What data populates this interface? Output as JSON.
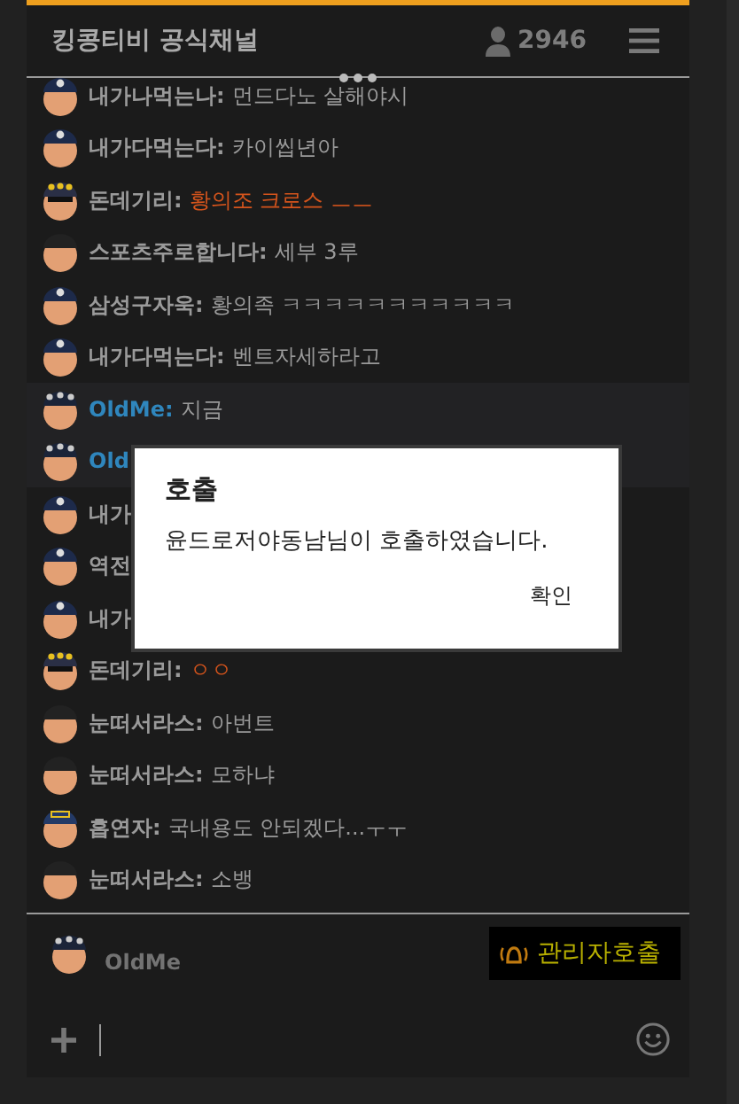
{
  "header": {
    "title": "킹콩티비 공식채널",
    "viewer_count": "2946"
  },
  "messages": [
    {
      "kind": "police",
      "name": "내가나먹는나:",
      "text": "먼드다노 살해야시",
      "self": false,
      "color": "#9a9a9a"
    },
    {
      "kind": "police",
      "name": "내가다먹는다:",
      "text": "카이씹년아",
      "self": false,
      "color": "#9a9a9a"
    },
    {
      "kind": "general",
      "name": "돈데기리:",
      "text": "황의조 크로스 ㅡㅡ",
      "self": false,
      "color": "#d4541c"
    },
    {
      "kind": "plain",
      "name": "스포츠주로합니다:",
      "text": "세부 3루",
      "self": false,
      "color": "#9a9a9a"
    },
    {
      "kind": "police",
      "name": "삼성구자욱:",
      "text": "황의족 ㅋㅋㅋㅋㅋㅋㅋㅋㅋㅋㅋ",
      "self": false,
      "color": "#9a9a9a"
    },
    {
      "kind": "police",
      "name": "내가다먹는다:",
      "text": "벤트자세하라고",
      "self": false,
      "color": "#9a9a9a"
    },
    {
      "kind": "starred",
      "name": "OldMe:",
      "text": "지금",
      "self": true,
      "color": "#9a9a9a"
    },
    {
      "kind": "starred",
      "name": "Old",
      "self": true
    },
    {
      "kind": "police",
      "name": "내가",
      "self": false
    },
    {
      "kind": "police",
      "name": "역전",
      "self": false
    },
    {
      "kind": "police",
      "name": "내가",
      "self": false
    },
    {
      "kind": "general",
      "name": "돈데기리:",
      "text": "ㅇㅇ",
      "self": false,
      "color": "#d4541c"
    },
    {
      "kind": "plain",
      "name": "눈떠서라스:",
      "text": "아번트",
      "self": false,
      "color": "#9a9a9a"
    },
    {
      "kind": "plain",
      "name": "눈떠서라스:",
      "text": "모하냐",
      "self": false,
      "color": "#9a9a9a"
    },
    {
      "kind": "cap",
      "name": "흡연자:",
      "text": "국내용도 안되겠다...ㅜㅜ",
      "self": false,
      "color": "#9a9a9a"
    },
    {
      "kind": "plain",
      "name": "눈떠서라스:",
      "text": "소뱅",
      "self": false,
      "color": "#9a9a9a"
    }
  ],
  "dialog": {
    "title": "호출",
    "message": "윤드로저야동남님이 호출하였습니다.",
    "button": "확인"
  },
  "footer": {
    "user": {
      "kind": "starred",
      "name": "OldMe"
    },
    "admin_call_button": "관리자호출"
  }
}
